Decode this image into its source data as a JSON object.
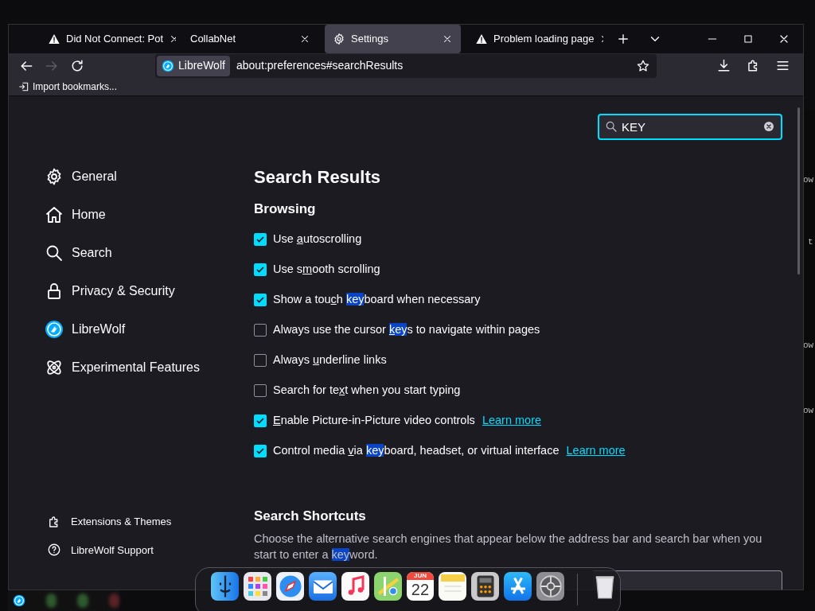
{
  "tabs": [
    {
      "kind": "warning",
      "label": "Did Not Connect: Pot",
      "selected": false
    },
    {
      "kind": "plain",
      "label": "CollabNet",
      "selected": false
    },
    {
      "kind": "settings",
      "label": "Settings",
      "selected": true
    },
    {
      "kind": "warning",
      "label": "Problem loading page",
      "selected": false
    }
  ],
  "nav": {
    "identity": "LibreWolf",
    "url": "about:preferences#searchResults",
    "forward_disabled": true
  },
  "bookmarks": [
    {
      "label": "Import bookmarks..."
    }
  ],
  "search": {
    "value": "KEY"
  },
  "sidebar": {
    "items": [
      {
        "kind": "general",
        "label": "General"
      },
      {
        "kind": "home",
        "label": "Home"
      },
      {
        "kind": "search",
        "label": "Search"
      },
      {
        "kind": "privacy",
        "label": "Privacy & Security"
      },
      {
        "kind": "librewolf",
        "label": "LibreWolf"
      },
      {
        "kind": "experimental",
        "label": "Experimental Features"
      }
    ],
    "footer": [
      {
        "kind": "extensions",
        "label": "Extensions & Themes"
      },
      {
        "kind": "support",
        "label": "LibreWolf Support"
      }
    ]
  },
  "title": "Search Results",
  "browsing": {
    "heading": "Browsing",
    "options": [
      {
        "checked": true,
        "parts": [
          {
            "kind": "plain",
            "text": "Use "
          },
          {
            "kind": "accesskey",
            "text": "a"
          },
          {
            "kind": "plain",
            "text": "utoscrolling"
          }
        ]
      },
      {
        "checked": true,
        "parts": [
          {
            "kind": "plain",
            "text": "Use s"
          },
          {
            "kind": "accesskey",
            "text": "m"
          },
          {
            "kind": "plain",
            "text": "ooth scrolling"
          }
        ]
      },
      {
        "checked": true,
        "parts": [
          {
            "kind": "plain",
            "text": "Show a tou"
          },
          {
            "kind": "accesskey",
            "text": "c"
          },
          {
            "kind": "plain",
            "text": "h "
          },
          {
            "kind": "match",
            "text": "key"
          },
          {
            "kind": "plain",
            "text": "board when necessary"
          }
        ]
      },
      {
        "checked": false,
        "parts": [
          {
            "kind": "plain",
            "text": "Always use the cursor "
          },
          {
            "kind": "match_accesskey",
            "text": "k"
          },
          {
            "kind": "match",
            "text": "ey"
          },
          {
            "kind": "plain",
            "text": "s to navigate within pages"
          }
        ]
      },
      {
        "checked": false,
        "parts": [
          {
            "kind": "plain",
            "text": "Always "
          },
          {
            "kind": "accesskey",
            "text": "u"
          },
          {
            "kind": "plain",
            "text": "nderline links"
          }
        ]
      },
      {
        "checked": false,
        "parts": [
          {
            "kind": "plain",
            "text": "Search for te"
          },
          {
            "kind": "accesskey",
            "text": "x"
          },
          {
            "kind": "plain",
            "text": "t when you start typing"
          }
        ]
      },
      {
        "checked": true,
        "parts": [
          {
            "kind": "accesskey",
            "text": "E"
          },
          {
            "kind": "plain",
            "text": "nable Picture-in-Picture video controls"
          }
        ],
        "link": "Learn more"
      },
      {
        "checked": true,
        "parts": [
          {
            "kind": "plain",
            "text": "Control media "
          },
          {
            "kind": "accesskey",
            "text": "v"
          },
          {
            "kind": "plain",
            "text": "ia "
          },
          {
            "kind": "match",
            "text": "key"
          },
          {
            "kind": "plain",
            "text": "board, headset, or virtual interface"
          }
        ],
        "link": "Learn more"
      }
    ]
  },
  "shortcuts": {
    "heading": "Search Shortcuts",
    "description": [
      {
        "kind": "plain",
        "text": "Choose the alternative search engines that appear below the address bar and search bar when you start to enter a "
      },
      {
        "kind": "match",
        "text": "key"
      },
      {
        "kind": "plain",
        "text": "word."
      }
    ]
  },
  "dock": {
    "items": [
      {
        "kind": "finder"
      },
      {
        "kind": "launchpad"
      },
      {
        "kind": "safari"
      },
      {
        "kind": "mail"
      },
      {
        "kind": "music"
      },
      {
        "kind": "maps"
      },
      {
        "kind": "calendar",
        "month": "JUN",
        "day": "22"
      },
      {
        "kind": "notes"
      },
      {
        "kind": "calculator"
      },
      {
        "kind": "appstore"
      },
      {
        "kind": "settings"
      },
      {
        "kind": "divider"
      },
      {
        "kind": "trash"
      }
    ]
  },
  "background_text": [
    "ow",
    "t",
    "ow",
    "ow"
  ]
}
